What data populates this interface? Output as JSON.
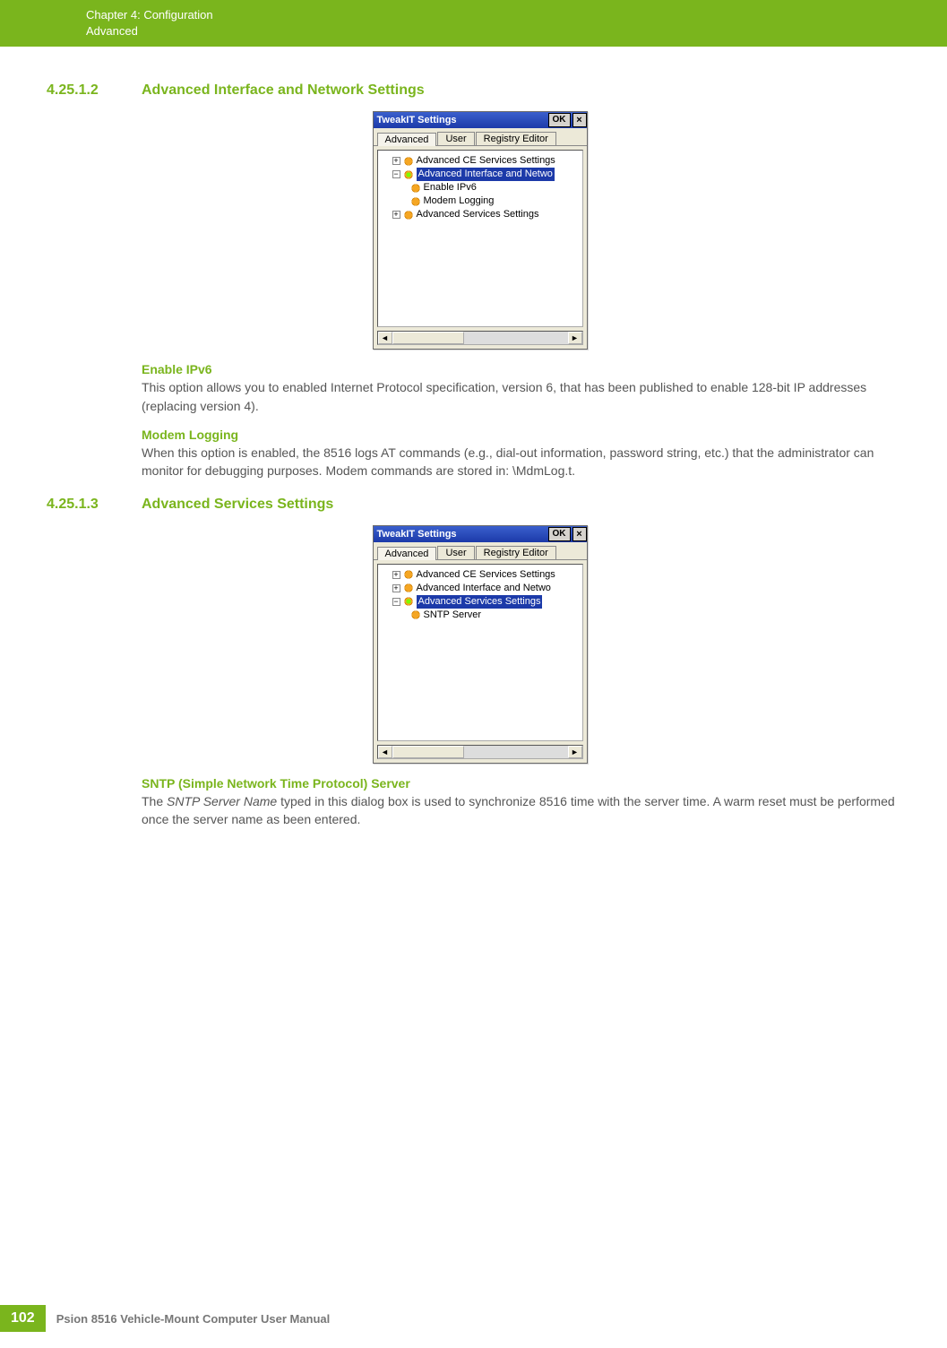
{
  "header": {
    "chapter_line": "Chapter 4:  Configuration",
    "section_line": "Advanced"
  },
  "section1": {
    "number": "4.25.1.2",
    "title": "Advanced Interface and Network Settings"
  },
  "dialog1": {
    "title": "TweakIT Settings",
    "ok": "OK",
    "close": "×",
    "tabs": {
      "advanced": "Advanced",
      "user": "User",
      "registry": "Registry Editor"
    },
    "tree": {
      "n1": "Advanced CE Services Settings",
      "n2": "Advanced Interface and Netwo",
      "n2a": "Enable IPv6",
      "n2b": "Modem Logging",
      "n3": "Advanced Services Settings"
    }
  },
  "enable_ipv6": {
    "heading": "Enable IPv6",
    "text": "This option allows you to enabled Internet Protocol specification, version 6, that has been published to enable 128-bit IP addresses (replacing version 4)."
  },
  "modem_logging": {
    "heading": "Modem Logging",
    "text": "When this option is enabled, the 8516 logs AT commands (e.g., dial-out information, password string, etc.) that the administrator can monitor for debugging purposes. Modem commands are stored in: \\MdmLog.t."
  },
  "section2": {
    "number": "4.25.1.3",
    "title": "Advanced Services Settings"
  },
  "dialog2": {
    "title": "TweakIT Settings",
    "ok": "OK",
    "close": "×",
    "tabs": {
      "advanced": "Advanced",
      "user": "User",
      "registry": "Registry Editor"
    },
    "tree": {
      "n1": "Advanced CE Services Settings",
      "n2": "Advanced Interface and Netwo",
      "n3": "Advanced Services Settings",
      "n3a": "SNTP Server"
    }
  },
  "sntp": {
    "heading": "SNTP (Simple Network Time Protocol) Server",
    "text_prefix": "The ",
    "text_em": "SNTP Server Name",
    "text_suffix": " typed in this dialog box is used to synchronize 8516 time with the server time. A warm reset must be performed once the server name as been entered."
  },
  "footer": {
    "page": "102",
    "manual": "Psion 8516 Vehicle-Mount Computer User Manual"
  }
}
